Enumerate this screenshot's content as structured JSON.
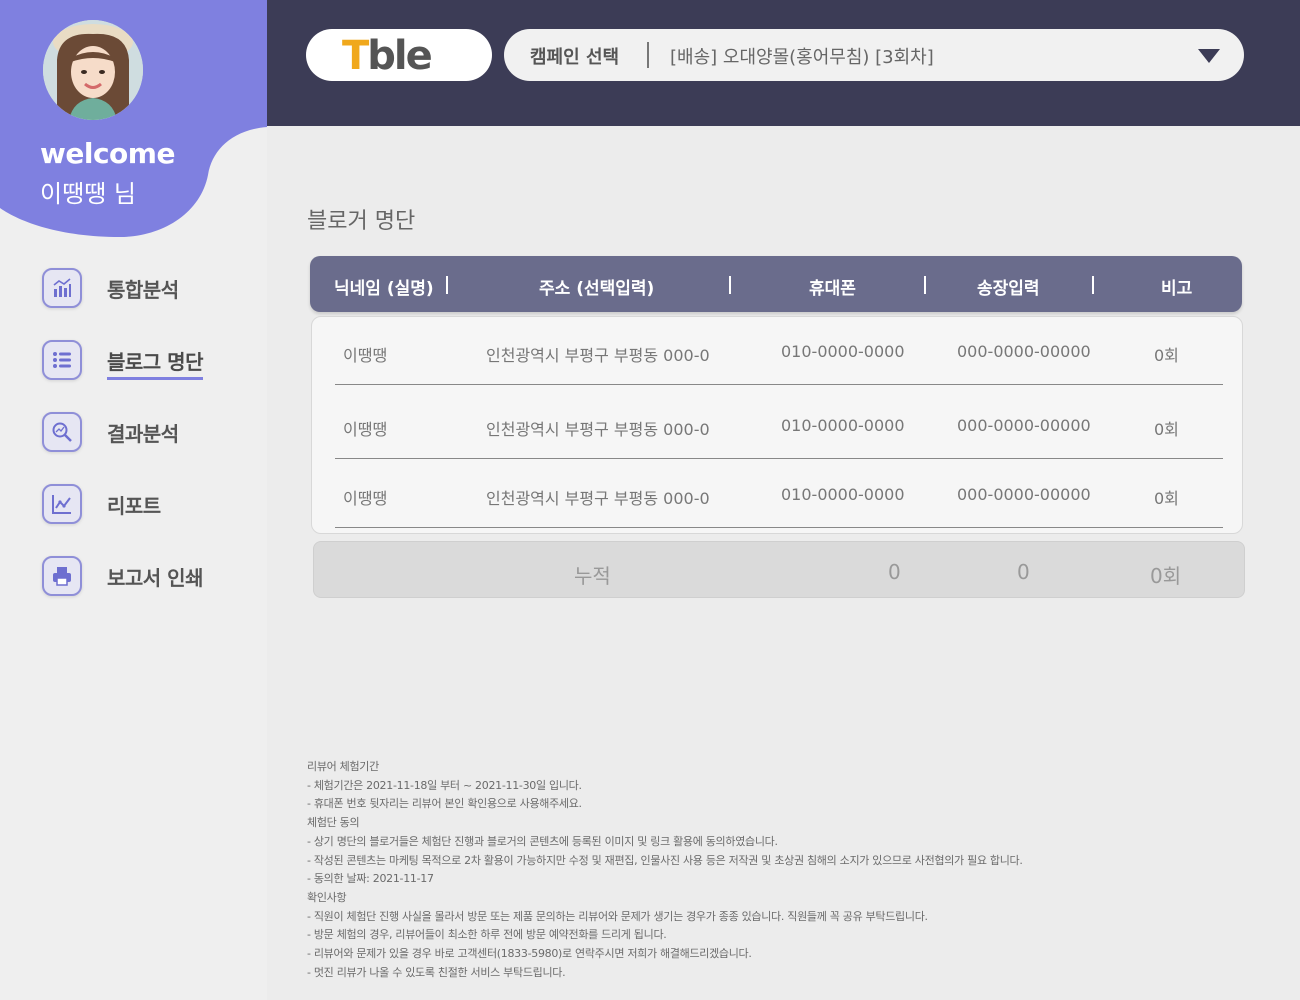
{
  "sidebar": {
    "welcome": "welcome",
    "username": "이땡땡 님",
    "items": [
      {
        "label": "통합분석",
        "icon": "bar-chart-icon"
      },
      {
        "label": "블로그 명단",
        "icon": "list-icon"
      },
      {
        "label": "결과분석",
        "icon": "magnifier-icon"
      },
      {
        "label": "리포트",
        "icon": "line-chart-icon"
      },
      {
        "label": "보고서 인쇄",
        "icon": "printer-icon"
      }
    ]
  },
  "header": {
    "logo": "Tble",
    "campaign_label": "캠페인 선택",
    "campaign_value": "[배송] 오대양몰(홍어무침) [3회차]"
  },
  "main": {
    "title": "블로거 명단",
    "columns": [
      "닉네임 (실명)",
      "주소 (선택입력)",
      "휴대폰",
      "송장입력",
      "비고"
    ],
    "rows": [
      {
        "nickname": "이땡땡",
        "address": "인천광역시 부평구 부평동 000-0",
        "phone": "010-0000-0000",
        "invoice": "000-0000-00000",
        "note": "0회"
      },
      {
        "nickname": "이땡땡",
        "address": "인천광역시 부평구 부평동 000-0",
        "phone": "010-0000-0000",
        "invoice": "000-0000-00000",
        "note": "0회"
      },
      {
        "nickname": "이땡땡",
        "address": "인천광역시 부평구 부평동 000-0",
        "phone": "010-0000-0000",
        "invoice": "000-0000-00000",
        "note": "0회"
      }
    ],
    "total": {
      "label": "누적",
      "phone": "0",
      "invoice": "0",
      "note": "0회"
    }
  },
  "notes": [
    "리뷰어 체험기간",
    "- 체험기간은 2021-11-18일 부터 ~ 2021-11-30일 입니다.",
    "- 휴대폰 번호 뒷자리는 리뷰어 본인 확인용으로 사용해주세요.",
    "체험단 동의",
    "- 상기 명단의 블로거들은 체험단 진행과 블로거의 콘텐츠에 등록된 이미지 및 링크 활용에 동의하였습니다.",
    "- 작성된 콘텐츠는 마케팅 목적으로 2차 활용이 가능하지만 수정 및 재편집, 인물사진 사용 등은 저작권 및 초상권 침해의 소지가 있으므로 사전협의가 필요 합니다.",
    "- 동의한 날짜: 2021-11-17",
    "확인사항",
    "- 직원이 체험단 진행 사실을 몰라서 방문 또는 제품 문의하는 리뷰어와 문제가 생기는 경우가 종종 있습니다. 직원들께 꼭 공유 부탁드립니다.",
    "- 방문 체험의 경우, 리뷰어들이 최소한 하루 전에 방문 예약전화를 드리게 됩니다.",
    "- 리뷰어와 문제가 있을 경우 바로 고객센터(1833-5980)로 연락주시면 저희가 해결해드리겠습니다.",
    "- 멋진 리뷰가 나올 수 있도록 친절한 서비스 부탁드립니다."
  ],
  "colors": {
    "accent": "#7f80e0",
    "header_bg": "#3c3c56",
    "table_head": "#6a6c8c",
    "logo_orange": "#f0a81c"
  }
}
